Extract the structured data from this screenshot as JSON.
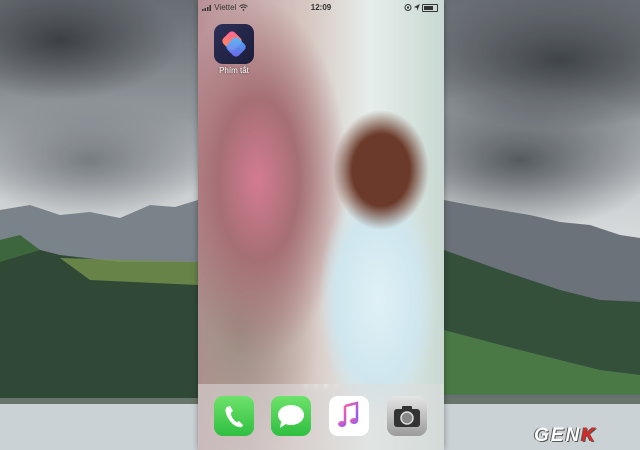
{
  "status_bar": {
    "carrier": "Viettel",
    "time": "12:09"
  },
  "home_screen": {
    "apps": [
      {
        "label": "Phím tắt",
        "icon": "shortcuts-icon"
      }
    ],
    "page_dots": 4,
    "active_page": 3
  },
  "dock": [
    {
      "icon": "phone-icon"
    },
    {
      "icon": "messages-icon"
    },
    {
      "icon": "music-icon"
    },
    {
      "icon": "camera-icon"
    }
  ],
  "watermark": {
    "prefix": "GEN",
    "suffix": "K"
  }
}
